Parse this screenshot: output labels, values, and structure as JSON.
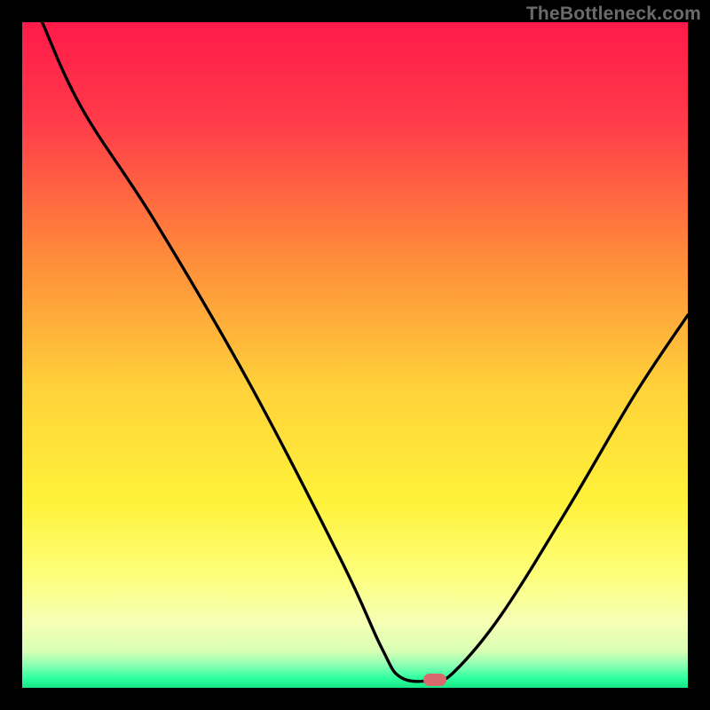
{
  "attribution": "TheBottleneck.com",
  "colors": {
    "frame": "#000000",
    "curve_stroke": "#000000",
    "marker_fill": "#d86a6d",
    "gradient_stops": [
      {
        "offset": 0.0,
        "color": "#ff1a4a"
      },
      {
        "offset": 0.15,
        "color": "#ff3b4a"
      },
      {
        "offset": 0.35,
        "color": "#ff8a3a"
      },
      {
        "offset": 0.55,
        "color": "#ffd23a"
      },
      {
        "offset": 0.72,
        "color": "#fff23a"
      },
      {
        "offset": 0.83,
        "color": "#fdff7a"
      },
      {
        "offset": 0.9,
        "color": "#f6ffb4"
      },
      {
        "offset": 0.945,
        "color": "#d8ffb4"
      },
      {
        "offset": 0.965,
        "color": "#8fffb4"
      },
      {
        "offset": 0.985,
        "color": "#2fffa0"
      },
      {
        "offset": 1.0,
        "color": "#17e884"
      }
    ]
  },
  "chart_data": {
    "type": "line",
    "title": "",
    "xlabel": "",
    "ylabel": "",
    "xlim": [
      0,
      100
    ],
    "ylim": [
      0,
      100
    ],
    "grid": false,
    "series": [
      {
        "name": "bottleneck-curve",
        "points": [
          {
            "x": 3.0,
            "y": 100.0
          },
          {
            "x": 9.0,
            "y": 87.0
          },
          {
            "x": 20.0,
            "y": 70.0
          },
          {
            "x": 34.0,
            "y": 46.0
          },
          {
            "x": 48.0,
            "y": 19.0
          },
          {
            "x": 54.0,
            "y": 6.0
          },
          {
            "x": 57.0,
            "y": 1.5
          },
          {
            "x": 62.0,
            "y": 1.2
          },
          {
            "x": 65.0,
            "y": 2.5
          },
          {
            "x": 72.0,
            "y": 11.0
          },
          {
            "x": 82.0,
            "y": 27.0
          },
          {
            "x": 92.0,
            "y": 44.0
          },
          {
            "x": 100.0,
            "y": 56.0
          }
        ]
      }
    ],
    "marker": {
      "x": 62.0,
      "y": 1.2,
      "name": "optimal-point"
    }
  }
}
